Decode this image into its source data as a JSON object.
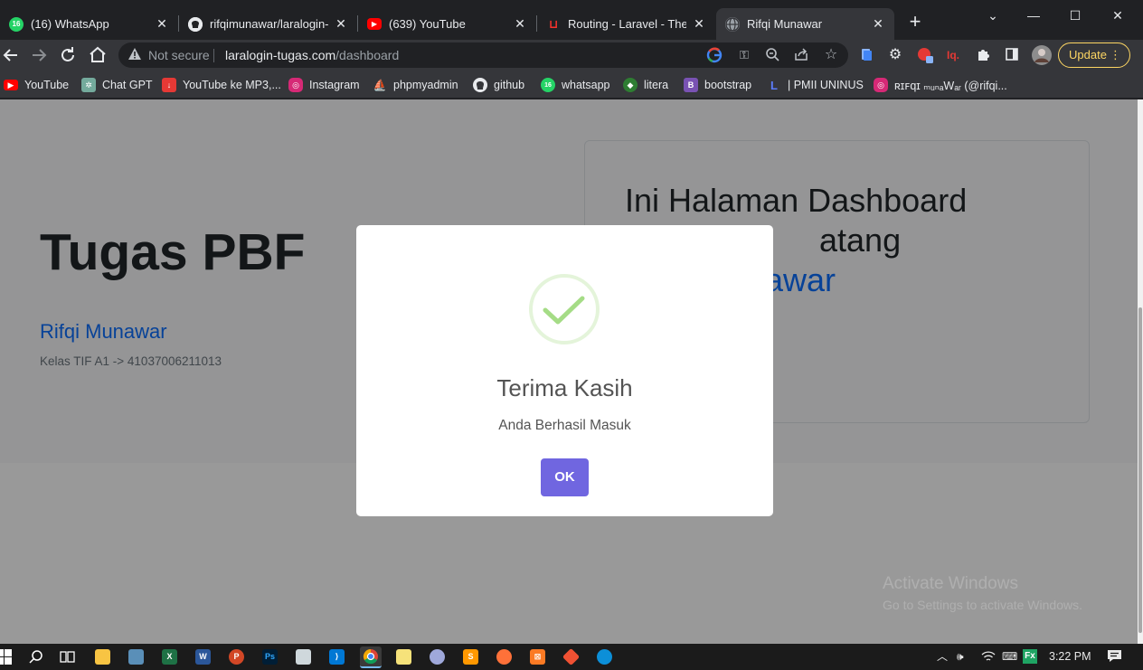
{
  "browser": {
    "tabs": [
      {
        "title": "(16) WhatsApp",
        "favicon": "whatsapp-icon",
        "badge": "16",
        "color": "#25d366"
      },
      {
        "title": "rifqimunawar/laralogin-tu",
        "favicon": "github-icon",
        "badge": "",
        "color": "#e8eaed"
      },
      {
        "title": "(639) YouTube",
        "favicon": "youtube-icon",
        "badge": "",
        "color": "#ff0000"
      },
      {
        "title": "Routing - Laravel - The Pl",
        "favicon": "laravel-icon",
        "badge": "",
        "color": "#f9322c"
      },
      {
        "title": "Rifqi Munawar",
        "favicon": "globe-icon",
        "badge": "",
        "color": "#9aa0a6"
      }
    ],
    "new_tab": "+",
    "window_controls": {
      "chevron": "⌄",
      "minimize": "—",
      "maximize": "☐",
      "close": "✕"
    },
    "address": {
      "security": "Not secure",
      "host": "laralogin-tugas.com",
      "path": "/dashboard"
    },
    "update_label": "Update",
    "bookmarks": [
      {
        "label": "YouTube",
        "icon": "youtube-icon",
        "color": "#ff0000",
        "glyph": "▶"
      },
      {
        "label": "Chat GPT",
        "icon": "chatgpt-icon",
        "color": "#74aa9c",
        "glyph": "✲"
      },
      {
        "label": "YouTube ke MP3,...",
        "icon": "download-icon",
        "color": "#e53935",
        "glyph": "↓"
      },
      {
        "label": "Instagram",
        "icon": "instagram-icon",
        "color": "#d62976",
        "glyph": "◎"
      },
      {
        "label": "phpmyadmin",
        "icon": "phpmyadmin-icon",
        "color": "#f89c0e",
        "glyph": "⛵"
      },
      {
        "label": "github",
        "icon": "github-icon",
        "color": "#35363a",
        "glyph": "●"
      },
      {
        "label": "whatsapp",
        "icon": "whatsapp-icon",
        "color": "#25d366",
        "glyph": "16"
      },
      {
        "label": "litera",
        "icon": "litera-icon",
        "color": "#2e7d32",
        "glyph": "◆"
      },
      {
        "label": "bootstrap",
        "icon": "bootstrap-icon",
        "color": "#7952b3",
        "glyph": "B"
      },
      {
        "label": "| PMII UNINUS",
        "icon": "laravel-icon",
        "color": "#3b5bdb",
        "glyph": "L"
      },
      {
        "label": "ʀɪꜰqɪ ₘᵤₙₐWₐᵣ (@rifqi...",
        "icon": "instagram-icon",
        "color": "#d62976",
        "glyph": "◎"
      }
    ]
  },
  "page": {
    "hero_title": "Tugas PBF",
    "name": "Rifqi Munawar",
    "info": "Kelas TIF A1 -> 41037006211013",
    "card_line1": "Ini Halaman Dashboard",
    "card_line2": "atang",
    "card_line3": "awar"
  },
  "modal": {
    "title": "Terima Kasih",
    "text": "Anda Berhasil Masuk",
    "ok_label": "OK",
    "icon": "success-check-icon",
    "accent": "#a5dc86",
    "button_color": "#7066e0"
  },
  "watermark": {
    "line1": "Activate Windows",
    "line2": "Go to Settings to activate Windows."
  },
  "taskbar": {
    "apps": [
      {
        "name": "windows-start-icon"
      },
      {
        "name": "search-icon"
      },
      {
        "name": "task-view-icon"
      },
      {
        "name": "file-explorer-icon"
      },
      {
        "name": "control-panel-icon"
      },
      {
        "name": "excel-icon"
      },
      {
        "name": "word-icon"
      },
      {
        "name": "powerpoint-icon"
      },
      {
        "name": "photoshop-icon"
      },
      {
        "name": "notepad-icon"
      },
      {
        "name": "vscode-icon"
      },
      {
        "name": "chrome-icon"
      },
      {
        "name": "notes-icon"
      },
      {
        "name": "app-icon"
      },
      {
        "name": "sublime-icon"
      },
      {
        "name": "firefox-icon"
      },
      {
        "name": "xampp-icon"
      },
      {
        "name": "git-icon"
      },
      {
        "name": "edge-icon"
      }
    ],
    "time": "3:22 PM"
  }
}
